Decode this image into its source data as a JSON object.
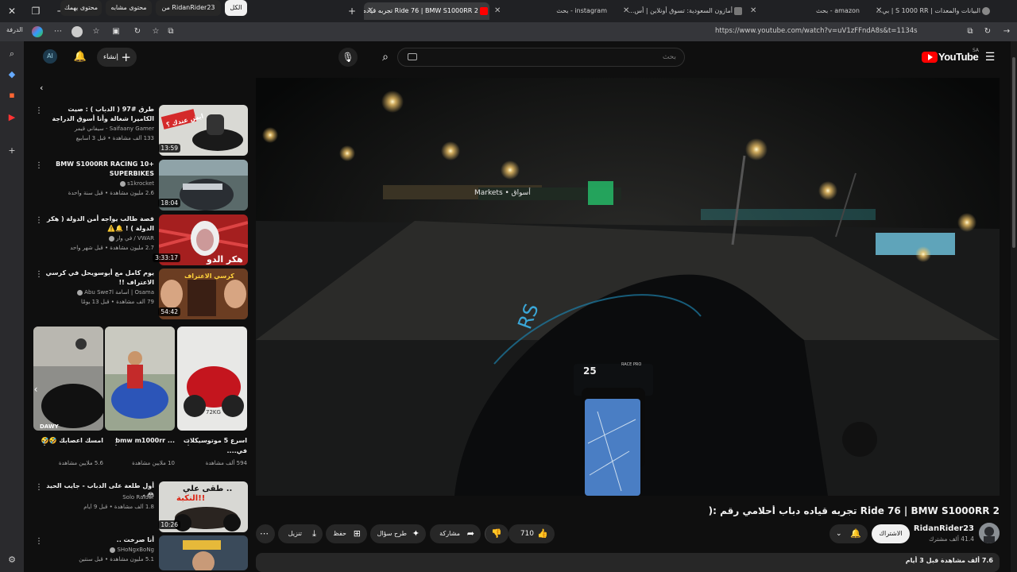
{
  "browser": {
    "brand_label": "الدرفة",
    "tabs": [
      {
        "label": "Ride 76 | BMW S1000RR 2 تجربه قياده دباب أحلامي رقم",
        "active": true
      },
      {
        "label": "instagram - بحث",
        "active": false
      },
      {
        "label": "أمازون السعودية: تسوق أونلاين | أس...",
        "active": false
      },
      {
        "label": "amazon - بحث",
        "active": false
      },
      {
        "label": "البيانات والمعدات | S 1000 RR | بي...",
        "active": false
      }
    ],
    "url": "https://www.youtube.com/watch?v=uV1zFFndA8s&t=1134s"
  },
  "header": {
    "logo_text": "YouTube",
    "logo_country": "SA",
    "search_placeholder": "بحث",
    "create_label": "إنشاء",
    "avatar_text": "AI"
  },
  "chips": [
    "الكل",
    "من RidanRider23",
    "محتوى مشابه",
    "محتوى يهمك"
  ],
  "recommendations": [
    {
      "title": "طرق #97 ( الدباب ) : صيت الكاميرا شغالة وأنا أسوق الدراجة",
      "channel": "Saifaany Gamer - سيفاني قيمر",
      "meta": "133 ألف مشاهدة • قبل 3 أسابيع",
      "duration": "13:59"
    },
    {
      "title": "BMW S1000RR RACING 10+ SUPERBIKES",
      "channel": "s1krocket",
      "meta": "2.6 مليون مشاهدة • قبل سنة واحدة",
      "duration": "18:04"
    },
    {
      "title": "قصة طالب يواجه أمن الدولة ( هكر الدولة ) ! 🔔⚠️",
      "channel": "VWAR / في وار",
      "meta": "2.7 مليون مشاهدة • قبل شهر واحد",
      "duration": "3:33:17"
    },
    {
      "title": "يوم كامل مع أبوسويحل في كرسي الاعتراف !!",
      "channel": "Osama | أسامة Abu Swe7l",
      "meta": "79 ألف مشاهدة • قبل 13 يومًا",
      "duration": "54:42"
    },
    {
      "title": "أول طلعة على الدباب - جايب الحيد 😳 -",
      "channel": "Solo Raider",
      "meta": "1.8 ألف مشاهدة • قبل 9 أيام",
      "duration": "10:26"
    },
    {
      "title": "أنا صرخت ..",
      "channel": "SHoNgxBoNg",
      "meta": "5.1 مليون مشاهدة • قبل سنتين",
      "duration": ""
    }
  ],
  "thumb_texts": {
    "rec0": "ايش عندك ؟",
    "rec2": "هكر الدو",
    "rec3": "كرسي الاعتراف",
    "rec4_a": "طقى علي ..",
    "rec4_b": "النكبة!!",
    "short0": "DAWY",
    "short2": "72KG"
  },
  "shorts": [
    {
      "title": "اسرع 5 موتوسيكلات في....",
      "views": "594 ألف مشاهدة"
    },
    {
      "title": "bmw m1000rr ...",
      "views": "10 ملايين مشاهدة"
    },
    {
      "title": "امسك اعصابك 🤣🤣",
      "views": "5.6 ملايين مشاهدة"
    }
  ],
  "player_overlay": {
    "market_sign": "Markets • أسواق",
    "speed": "25",
    "dash_unit": "RACE PRO"
  },
  "video": {
    "title": "Ride 76 | BMW S1000RR 2 تجربه قياده دباب أحلامي رقم :(",
    "channel": "RidanRider23",
    "subscribers": "41.4 ألف مشترك",
    "subscribe_label": "الاشتراك",
    "likes": "710",
    "share_label": "مشاركة",
    "ask_label": "طرح سؤال",
    "save_label": "حفظ",
    "download_label": "تنزيل",
    "description_meta": "7.6 ألف مشاهدة قبل 3 أيام"
  },
  "colors": {
    "accent": "#ff0000",
    "background": "#0f0f0f",
    "chip": "#272727"
  }
}
